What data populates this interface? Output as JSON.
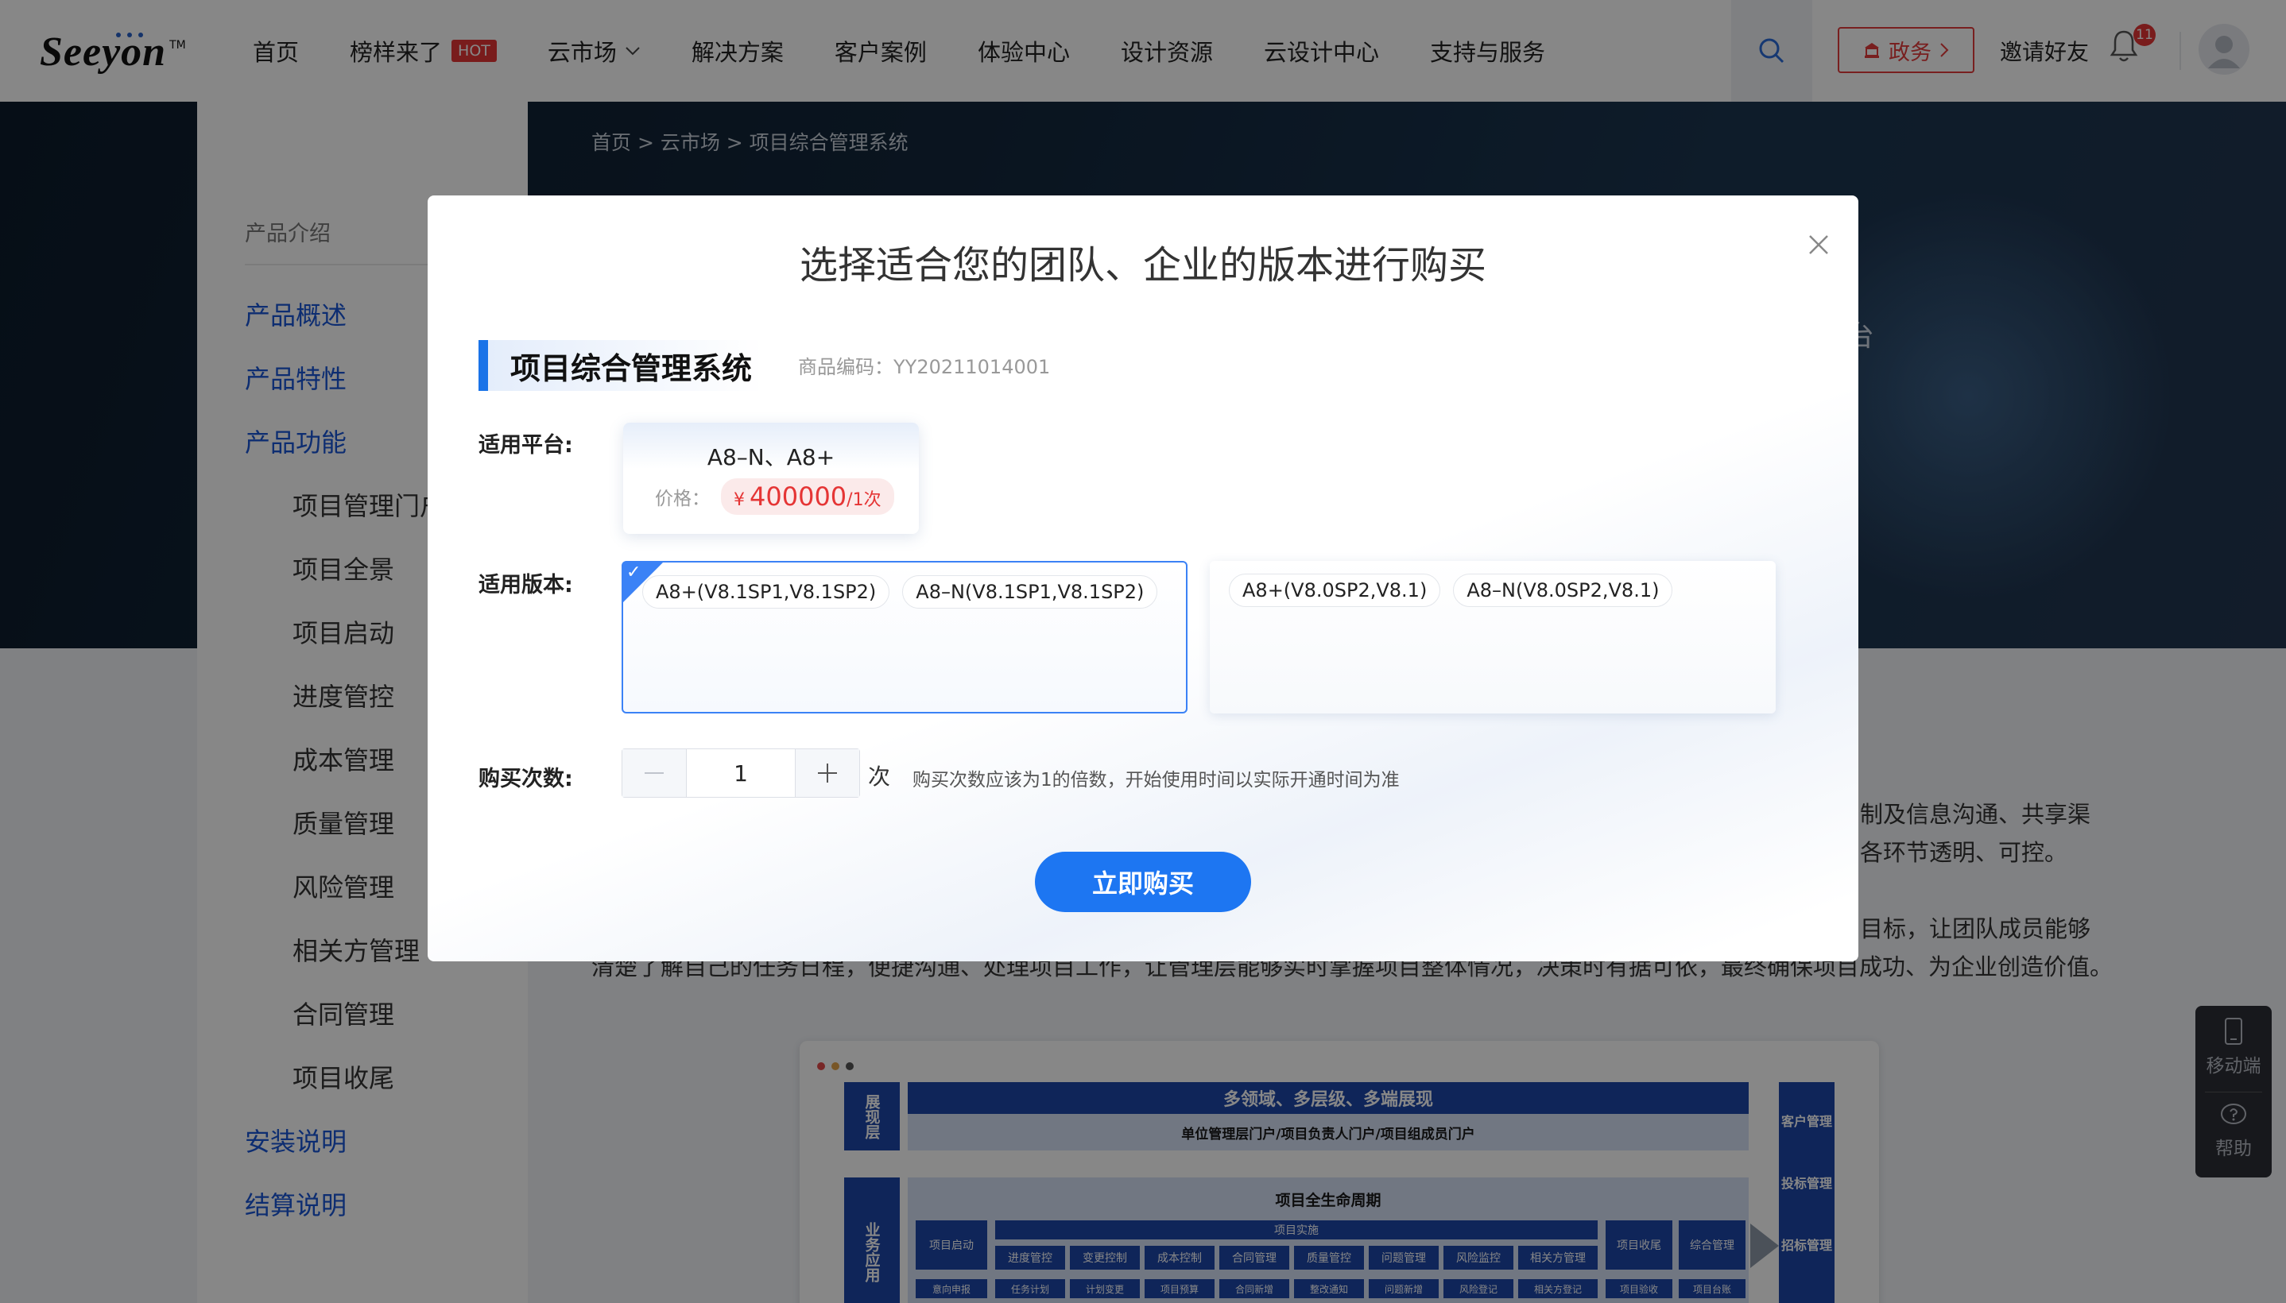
{
  "nav": {
    "logo": "Seeyon",
    "logo_tm": "TM",
    "menu": [
      {
        "label": "首页"
      },
      {
        "label": "榜样来了",
        "badge": "HOT"
      },
      {
        "label": "云市场"
      },
      {
        "label": "解决方案"
      },
      {
        "label": "客户案例"
      },
      {
        "label": "体验中心"
      },
      {
        "label": "设计资源"
      },
      {
        "label": "云设计中心"
      },
      {
        "label": "支持与服务"
      }
    ],
    "gov_button": "政务",
    "invite": "邀请好友",
    "notification_count": "11",
    "icons": {
      "search": "search-icon",
      "bell": "bell-icon",
      "avatar": "user-avatar-icon"
    }
  },
  "breadcrumb": "首页 > 云市场 > 项目综合管理系统",
  "hero_fragment": "台",
  "sidebar": {
    "heading": "产品介绍",
    "items": [
      "产品概述",
      "产品特性",
      "产品功能"
    ],
    "sub_items": [
      "项目管理门户",
      "项目全景",
      "项目启动",
      "进度管控",
      "成本管理",
      "质量管理",
      "风险管理",
      "相关方管理",
      "合同管理",
      "项目收尾"
    ],
    "bottom_items": [
      "安装说明",
      "结算说明"
    ]
  },
  "body_text": {
    "line1": "制及信息沟通、共享渠",
    "line2": "各环节透明、可控。",
    "line3": "目标，让团队成员能够",
    "line4": "清楚了解自己的任务日程，便捷沟通、处理项目工作，让管理层能够实时掌握项目整体情况，决策时有据可依，最终确保项目成功、为企业创造价值。"
  },
  "diagram": {
    "left_top": "展现层",
    "left_bottom": "业务应用",
    "top_title": "多领域、多层级、多端展现",
    "top_sub": "单位管理层门户/项目负责人门户/项目组成员门户",
    "mid_title": "项目全生命周期",
    "start": "项目启动",
    "impl": "项目实施",
    "close": "项目收尾",
    "combo": "综合管理",
    "modules": [
      "进度管控",
      "变更控制",
      "成本控制",
      "合同管理",
      "质量管控",
      "问题管理",
      "风险监控",
      "相关方管理"
    ],
    "row2": [
      "意向申报",
      "任务计划",
      "计划变更",
      "项目预算",
      "合同新增",
      "整改通知",
      "问题新增",
      "风险登记",
      "相关方登记",
      "项目验收",
      "项目台账"
    ],
    "right": [
      "客户管理",
      "投标管理",
      "招标管理"
    ]
  },
  "modal": {
    "title": "选择适合您的团队、企业的版本进行购买",
    "product_name": "项目综合管理系统",
    "product_code": "商品编码：YY20211014001",
    "platform_label": "适用平台:",
    "platform_name": "A8–N、A8+",
    "price_label": "价格：",
    "price_currency": "¥",
    "price_value": "400000",
    "price_unit": "/1次",
    "version_label": "适用版本:",
    "version_options": [
      {
        "selected": true,
        "tags": [
          "A8+(V8.1SP1,V8.1SP2)",
          "A8–N(V8.1SP1,V8.1SP2)"
        ]
      },
      {
        "selected": false,
        "tags": [
          "A8+(V8.0SP2,V8.1)",
          "A8–N(V8.0SP2,V8.1)"
        ]
      }
    ],
    "count_label": "购买次数:",
    "count_value": "1",
    "count_unit": "次",
    "count_hint": "购买次数应该为1的倍数，开始使用时间以实际开通时间为准",
    "buy_button": "立即购买"
  },
  "float_panel": {
    "mobile": "移动端",
    "help": "帮助"
  },
  "colors": {
    "brand_blue": "#1d76f2",
    "hot_red": "#e53535",
    "sidebar_active": "#1a56d6"
  }
}
